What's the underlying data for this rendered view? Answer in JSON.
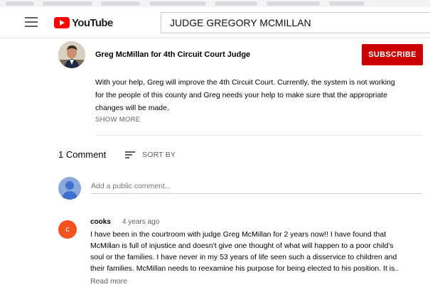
{
  "header": {
    "brand": "YouTube",
    "search_value": "JUDGE GREGORY MCMILLAN"
  },
  "channel": {
    "name": "Greg McMillan for 4th Circuit Court Judge",
    "subscribe_label": "SUBSCRIBE",
    "description_lines": [
      "With your help, Greg will improve the 4th Circuit Court. Currently, the system is not working",
      "for the people of this county and Greg needs your help to make sure that the appropriate",
      "changes will be made."
    ],
    "show_more_label": "SHOW MORE"
  },
  "comments": {
    "count_label": "1 Comment",
    "sort_label": "SORT BY",
    "add_placeholder": "Add a public comment...",
    "items": [
      {
        "avatar_letter": "c",
        "author": "cooks",
        "time": "4 years ago",
        "text_lines": [
          "I have been in the courtroom with judge Greg McMillan for 2 years now!! I have found that",
          "McMillan is full of injustice and doesn't give one thought of what will happen to a poor child's",
          "soul or the families. I have never in my 53 years of life seen such a disservice to children and",
          "their families. McMillan needs to reexamine his purpose for being elected to his position. It is.."
        ],
        "read_more_label": "Read more"
      }
    ]
  },
  "colors": {
    "brand_red": "#ff0000",
    "subscribe_red": "#cc0000",
    "comment_avatar": "#f4511e",
    "secondary_text": "#606060"
  }
}
